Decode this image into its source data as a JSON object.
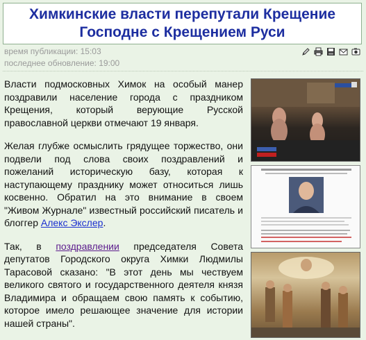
{
  "article": {
    "title_line1": "Химкинские власти перепутали Крещение",
    "title_line2": "Господне с Крещением Руси",
    "published": "время публикации: 15:03",
    "updated": "последнее обновление: 19:00",
    "p1": "Власти подмосковных Химок на особый манер поздравили население города с праздником Крещения, который верующие Русской православной церкви отмечают 19 января.",
    "p2_text": "Желая глубже осмыслить грядущее торжество, они подвели под слова своих поздравлений и пожеланий историческую базу, которая к наступающему празднику может относиться лишь косвенно. Обратил на это внимание в своем \"Живом Журнале\" известный российский писатель и блоггер ",
    "p2_link": "Алекс Экслер",
    "p2_end": ".",
    "p3_start": "Так, в ",
    "p3_link": "поздравлении",
    "p3_text": " председателя Совета депутатов Городского округа Химки Людмилы Тарасовой сказано: \"В этот день мы чествуем великого святого и государственного деятеля князя Владимира и обращаем свою память к событию, которое имело решающее значение для истории нашей страны\"."
  },
  "toolbar": {
    "icons": [
      "edit-icon",
      "print-icon",
      "save-icon",
      "email-icon",
      "photo-icon"
    ]
  },
  "colors": {
    "title": "#1d2ea0",
    "background": "#eaf3e6",
    "link": "#1a2fd0",
    "visited_link": "#5b1a8c"
  }
}
